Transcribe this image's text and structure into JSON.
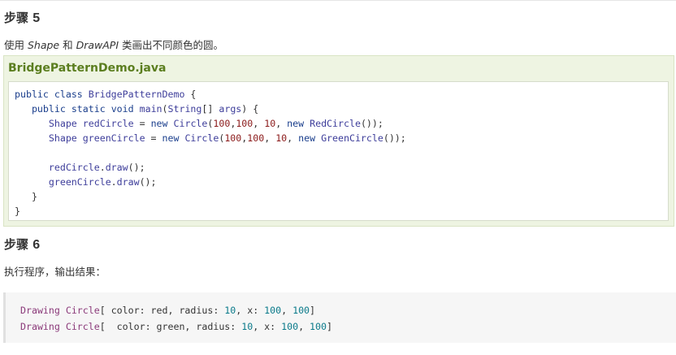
{
  "step5": {
    "label": "步骤",
    "number": "5",
    "desc_prefix": "使用 ",
    "desc_shape": "Shape",
    "desc_and": " 和 ",
    "desc_drawapi": "DrawAPI",
    "desc_suffix": " 类画出不同颜色的圆。"
  },
  "example": {
    "filename": "BridgePatternDemo.java",
    "code_lines": [
      "public class BridgePatternDemo {",
      "   public static void main(String[] args) {",
      "      Shape redCircle = new Circle(100,100, 10, new RedCircle());",
      "      Shape greenCircle = new Circle(100,100, 10, new GreenCircle());",
      "",
      "      redCircle.draw();",
      "      greenCircle.draw();",
      "   }",
      "}"
    ]
  },
  "step6": {
    "label": "步骤",
    "number": "6",
    "desc": "执行程序，输出结果："
  },
  "output": {
    "lines": [
      "Drawing Circle[ color: red, radius: 10, x: 100, 100]",
      "Drawing Circle[  color: green, radius: 10, x: 100, 100]"
    ]
  }
}
